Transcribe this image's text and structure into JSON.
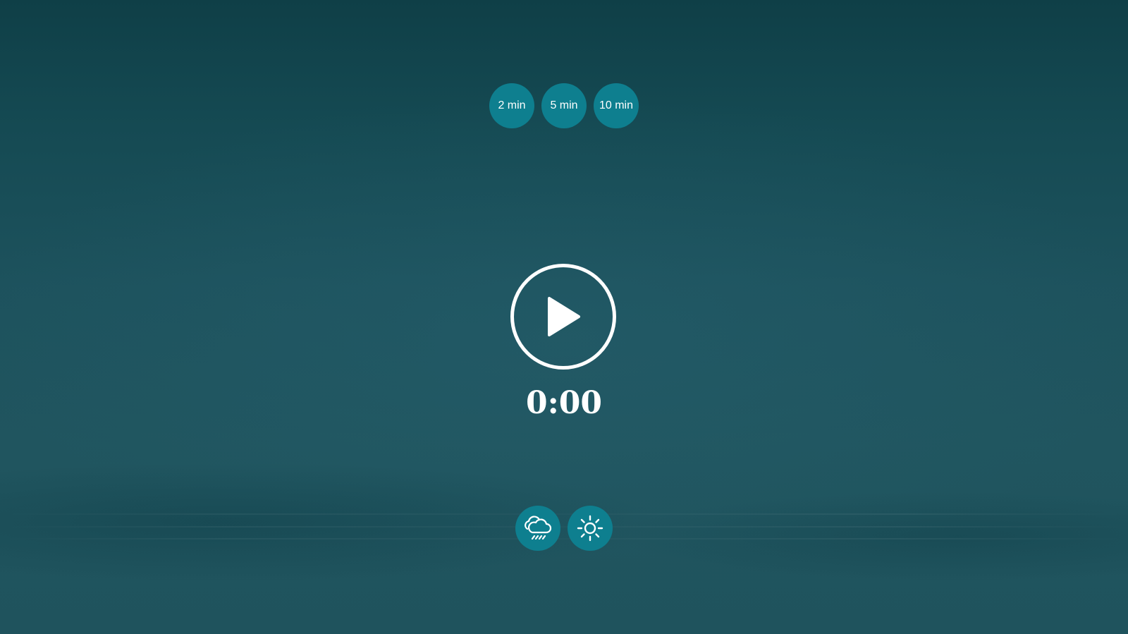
{
  "durations": [
    {
      "label": "2 min"
    },
    {
      "label": "5 min"
    },
    {
      "label": "10 min"
    }
  ],
  "player": {
    "icon": "play-icon",
    "time": "0:00"
  },
  "sounds": [
    {
      "icon": "rain-cloud-icon"
    },
    {
      "icon": "sun-icon"
    }
  ],
  "colors": {
    "button_bg": "#0e7f8f",
    "foreground": "#ffffff",
    "background": "#1d525d"
  }
}
